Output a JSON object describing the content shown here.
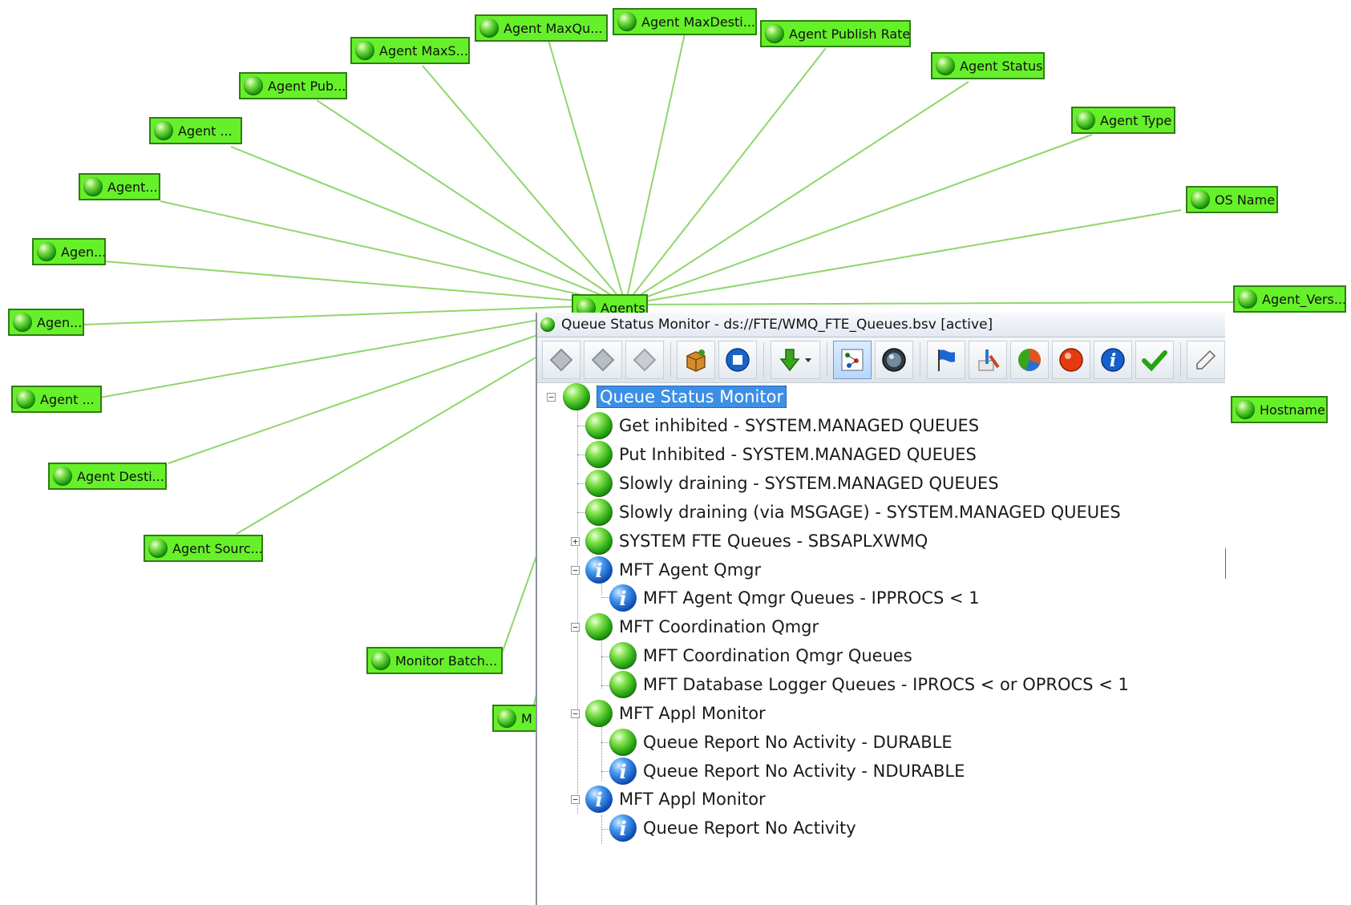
{
  "graph": {
    "hub": {
      "label": "Agents"
    },
    "nodes": [
      {
        "label": "Agent MaxQu..."
      },
      {
        "label": "Agent MaxDesti..."
      },
      {
        "label": "Agent Publish Rate"
      },
      {
        "label": "Agent MaxS..."
      },
      {
        "label": "Agent Status"
      },
      {
        "label": "Agent Pub..."
      },
      {
        "label": "Agent Type"
      },
      {
        "label": "Agent ..."
      },
      {
        "label": "OS Name"
      },
      {
        "label": "Agent..."
      },
      {
        "label": "Agen..."
      },
      {
        "label": "Agent_Vers..."
      },
      {
        "label": "Agen..."
      },
      {
        "label": "Agent ..."
      },
      {
        "label": "Hostname"
      },
      {
        "label": "Agent Desti..."
      },
      {
        "label": "Agent Sourc..."
      },
      {
        "label": "Monitor Batch..."
      },
      {
        "label": "M"
      }
    ]
  },
  "panel": {
    "title": "Queue Status Monitor - ds://FTE/WMQ_FTE_Queues.bsv [active]",
    "toolbar": [
      "diamond-icon",
      "diamond-icon",
      "diamond-icon",
      "package-icon",
      "stop-icon",
      "download-arrow-icon",
      "dependency-graph-icon",
      "globe-icon",
      "flag-icon",
      "tools-icon",
      "pie-chart-icon",
      "alarm-icon",
      "info-icon",
      "checkmark-icon",
      "edit-icon"
    ],
    "tree": [
      {
        "label": "Queue Status Monitor",
        "status": "ok",
        "selected": true
      },
      {
        "label": "Get inhibited - SYSTEM.MANAGED QUEUES",
        "status": "ok"
      },
      {
        "label": "Put Inhibited - SYSTEM.MANAGED QUEUES",
        "status": "ok"
      },
      {
        "label": "Slowly draining - SYSTEM.MANAGED QUEUES",
        "status": "ok"
      },
      {
        "label": "Slowly draining (via MSGAGE) - SYSTEM.MANAGED QUEUES",
        "status": "ok"
      },
      {
        "label": "SYSTEM FTE Queues - SBSAPLXWMQ",
        "status": "ok",
        "expander": "+"
      },
      {
        "label": "MFT Agent Qmgr",
        "status": "info",
        "expander": "-"
      },
      {
        "label": "MFT Agent Qmgr Queues - IPPROCS < 1",
        "status": "info"
      },
      {
        "label": "MFT Coordination Qmgr",
        "status": "ok",
        "expander": "-"
      },
      {
        "label": "MFT Coordination Qmgr Queues",
        "status": "ok"
      },
      {
        "label": "MFT Database Logger Queues - IPROCS < or OPROCS < 1",
        "status": "ok"
      },
      {
        "label": "MFT Appl Monitor",
        "status": "ok",
        "expander": "-"
      },
      {
        "label": "Queue Report No Activity - DURABLE",
        "status": "ok"
      },
      {
        "label": "Queue Report No Activity - NDURABLE",
        "status": "info"
      },
      {
        "label": "MFT Appl Monitor",
        "status": "info",
        "expander": "-"
      },
      {
        "label": "Queue Report No Activity",
        "status": "info"
      }
    ]
  },
  "colors": {
    "node_fill": "#66f02a",
    "edge": "#8fd66a",
    "selection": "#3d8fe6"
  }
}
